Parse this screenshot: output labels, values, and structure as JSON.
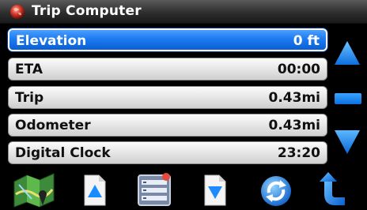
{
  "window": {
    "title": "Trip Computer",
    "app_icon": "globe-icon"
  },
  "rows": [
    {
      "label": "Elevation",
      "value": "0 ft",
      "selected": true
    },
    {
      "label": "ETA",
      "value": "00:00",
      "selected": false
    },
    {
      "label": "Trip",
      "value": "0.43mi",
      "selected": false
    },
    {
      "label": "Odometer",
      "value": "0.43mi",
      "selected": false
    },
    {
      "label": "Digital Clock",
      "value": "23:20",
      "selected": false
    }
  ],
  "scroll": {
    "up_icon": "triangle-up-icon",
    "down_icon": "triangle-down-icon"
  },
  "toolbar": {
    "buttons": [
      {
        "icon": "map-icon"
      },
      {
        "icon": "page-up-icon"
      },
      {
        "icon": "menu-list-icon"
      },
      {
        "icon": "page-down-icon"
      },
      {
        "icon": "refresh-icon"
      },
      {
        "icon": "back-arrow-icon"
      }
    ]
  },
  "colors": {
    "selection_blue": "#1e7af0",
    "arrow_blue": "#1b8cff",
    "title_bg": "#2e2e2e"
  }
}
